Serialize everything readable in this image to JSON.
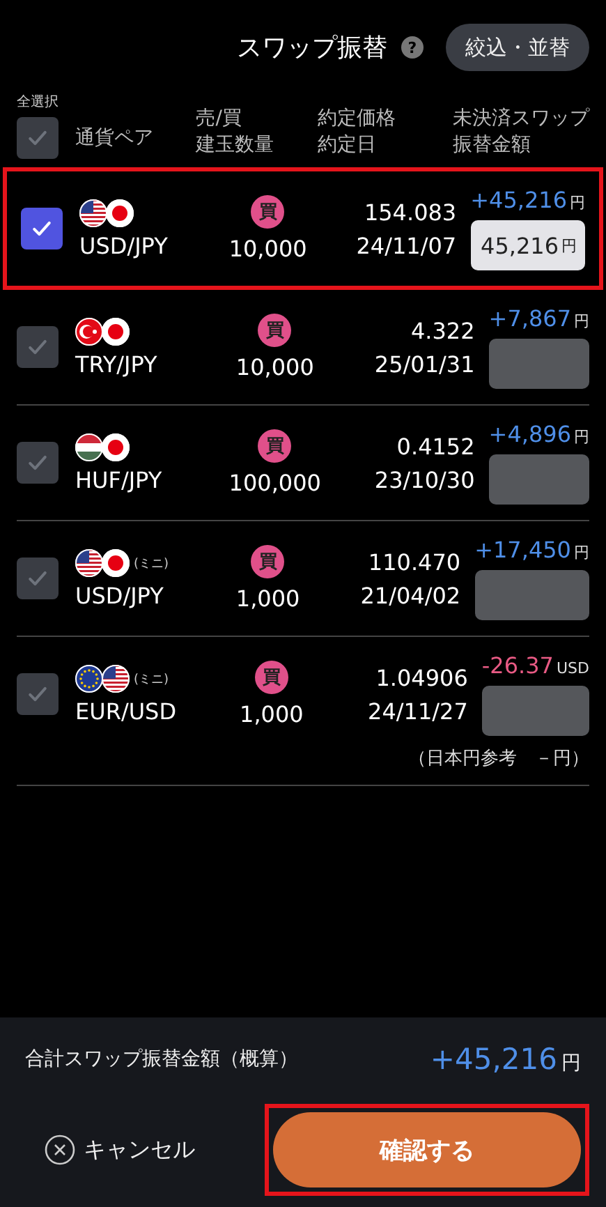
{
  "header": {
    "title": "スワップ振替",
    "help_icon": "?",
    "filter_button": "絞込・並替"
  },
  "columns": {
    "select_all": "全選択",
    "select_all_checked": false,
    "pair": "通貨ペア",
    "side_qty": [
      "売/買",
      "建玉数量"
    ],
    "price_date": [
      "約定価格",
      "約定日"
    ],
    "amount": [
      "未決済スワップ",
      "振替金額"
    ]
  },
  "rows": [
    {
      "checked": true,
      "highlighted": true,
      "flags": [
        {
          "kind": "us"
        },
        {
          "kind": "jp"
        }
      ],
      "pair": "USD/JPY",
      "side": "買",
      "quantity": "10,000",
      "price": "154.083",
      "date": "24/11/07",
      "swap": {
        "kind": "positive",
        "amount": "+45,216",
        "unit": "円"
      },
      "transfer": {
        "disabled": false,
        "value": "45,216",
        "unit": "円"
      }
    },
    {
      "checked": false,
      "highlighted": false,
      "flags": [
        {
          "kind": "tr"
        },
        {
          "kind": "jp"
        }
      ],
      "pair": "TRY/JPY",
      "side": "買",
      "quantity": "10,000",
      "price": "4.322",
      "date": "25/01/31",
      "swap": {
        "kind": "positive",
        "amount": "+7,867",
        "unit": "円"
      },
      "transfer": {
        "disabled": true
      }
    },
    {
      "checked": false,
      "highlighted": false,
      "flags": [
        {
          "kind": "hu"
        },
        {
          "kind": "jp"
        }
      ],
      "pair": "HUF/JPY",
      "side": "買",
      "quantity": "100,000",
      "price": "0.4152",
      "date": "23/10/30",
      "swap": {
        "kind": "positive",
        "amount": "+4,896",
        "unit": "円"
      },
      "transfer": {
        "disabled": true
      }
    },
    {
      "checked": false,
      "highlighted": false,
      "flags": [
        {
          "kind": "us"
        },
        {
          "kind": "jp"
        }
      ],
      "mini": "(ミニ)",
      "pair": "USD/JPY",
      "side": "買",
      "quantity": "1,000",
      "price": "110.470",
      "date": "21/04/02",
      "swap": {
        "kind": "positive",
        "amount": "+17,450",
        "unit": "円"
      },
      "transfer": {
        "disabled": true
      }
    },
    {
      "checked": false,
      "highlighted": false,
      "flags": [
        {
          "kind": "eu"
        },
        {
          "kind": "us"
        }
      ],
      "mini": "(ミニ)",
      "pair": "EUR/USD",
      "side": "買",
      "quantity": "1,000",
      "price": "1.04906",
      "date": "24/11/27",
      "swap": {
        "kind": "negative",
        "amount": "-26.37",
        "unit": "USD"
      },
      "transfer": {
        "disabled": true
      },
      "note": "（日本円参考　－円）"
    }
  ],
  "footer": {
    "total_label": "合計スワップ振替金額（概算）",
    "total": "+45,216",
    "total_unit": "円",
    "cancel": "キャンセル",
    "confirm": "確認する",
    "confirm_highlighted": true
  }
}
